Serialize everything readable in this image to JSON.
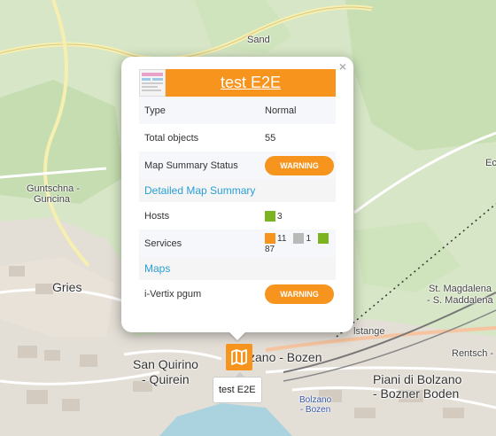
{
  "map": {
    "places": {
      "sand": "Sand",
      "guntschna": "Guntschna -",
      "guncina": "Guncina",
      "gries": "Gries",
      "san_quirino": "San Quirino",
      "quirein": "- Quirein",
      "bozen": "zano - Bozen",
      "st_magdalena": "St. Magdalena",
      "s_maddalena": "- S. Maddalena",
      "rentsch": "Rentsch -",
      "piani": "Piani di Bolzano",
      "bozner_boden": "- Bozner Boden",
      "stange": "lstange",
      "ec": "Ec",
      "station_1": "Bolzano",
      "station_2": "- Bozen"
    }
  },
  "popup": {
    "close": "×",
    "title": "test E2E",
    "rows": {
      "type_label": "Type",
      "type_value": "Normal",
      "objects_label": "Total objects",
      "objects_value": "55",
      "status_label": "Map Summary Status",
      "status_value": "WARNING"
    },
    "detailed_header": "Detailed Map Summary",
    "hosts_label": "Hosts",
    "hosts": [
      {
        "color": "#7cb320",
        "count": "3"
      }
    ],
    "services_label": "Services",
    "services": [
      {
        "color": "#f7941e",
        "count": "11"
      },
      {
        "color": "#b9b9b9",
        "count": "1"
      },
      {
        "color": "#7cb320",
        "count": "87"
      }
    ],
    "maps_header": "Maps",
    "map_item_label": "i-Vertix pgum",
    "map_item_status": "WARNING"
  },
  "marker": {
    "icon": "map-icon",
    "tooltip": "test E2E"
  },
  "colors": {
    "accent": "#f7941e",
    "ok": "#7cb320",
    "unknown": "#b9b9b9",
    "link": "#2a9fd6"
  }
}
